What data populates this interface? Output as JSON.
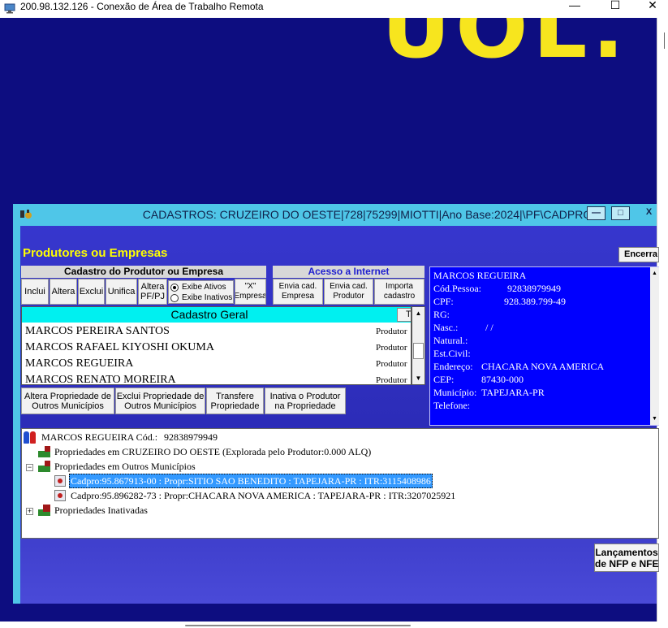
{
  "rdp_window": {
    "title": "200.98.132.126 - Conexão de Área de Trabalho Remota",
    "minimize_glyph": "—",
    "maximize_glyph": "☐",
    "close_glyph": "✕"
  },
  "desktop": {
    "wallpaper_text": "UOL."
  },
  "app_window": {
    "title": "CADASTROS: CRUZEIRO DO OESTE|728|75299|MIOTTI|Ano Base:2024|\\PF\\CADPRO",
    "minimize_glyph": "—",
    "maximize_glyph": "□",
    "close_glyph": "X"
  },
  "section_title": "Produtores ou Empresas",
  "encerra_label": "Encerra",
  "cadastro_panel": {
    "header": "Cadastro do Produtor ou Empresa",
    "buttons": [
      "Inclui",
      "Altera",
      "Exclui",
      "Unifica",
      "Altera PF/PJ",
      "\"X\" Empresa"
    ],
    "radio_options": [
      "Exibe Ativos",
      "Exibe Inativos"
    ],
    "radio_selected": "Exibe Ativos"
  },
  "internet_panel": {
    "header": "Acesso a Internet",
    "buttons": [
      "Envia cad. Empresa",
      "Envia cad. Produtor",
      "Importa cadastro"
    ]
  },
  "cadastro_geral": {
    "title": "Cadastro Geral",
    "tipo_header": "Tipo",
    "rows": [
      {
        "name": "MARCOS PEREIRA SANTOS",
        "tipo": "Produtor"
      },
      {
        "name": "MARCOS RAFAEL KIYOSHI OKUMA",
        "tipo": "Produtor"
      },
      {
        "name": "MARCOS REGUEIRA",
        "tipo": "Produtor"
      },
      {
        "name": "MARCOS RENATO MOREIRA",
        "tipo": "Produtor"
      }
    ]
  },
  "action_buttons": [
    "Altera Propriedade de Outros Municípios",
    "Exclui Propriedade de Outros Municípios",
    "Transfere Propriedade",
    "Inativa o Produtor na Propriedade"
  ],
  "details": {
    "name": "MARCOS REGUEIRA",
    "cod_pessoa_label": "Cód.Pessoa:",
    "cod_pessoa": "92838979949",
    "cpf_label": "CPF:",
    "cpf": "928.389.799-49",
    "rg_label": "RG:",
    "nasc_label": "Nasc.:",
    "nasc": "/ /",
    "natural_label": "Natural.:",
    "est_civil_label": "Est.Civil:",
    "endereco_label": "Endereço:",
    "endereco": "CHACARA NOVA AMERICA",
    "cep_label": "CEP:",
    "cep": "87430-000",
    "municipio_label": "Município:",
    "municipio": "TAPEJARA-PR",
    "telefone_label": "Telefone:"
  },
  "tree": {
    "root": "MARCOS REGUEIRA Cód.:",
    "root_code": "92838979949",
    "node_cruzeiro": "Propriedades em CRUZEIRO DO OESTE (Explorada pelo Produtor:0.000 ALQ)",
    "node_outros": "Propriedades em Outros Municípios",
    "children": [
      "Cadpro:95.867913-00  :  Propr:SITIO SAO BENEDITO  :  TAPEJARA-PR  :  ITR:3115408986",
      "Cadpro:95.896282-73  :  Propr:CHACARA NOVA AMERICA  :  TAPEJARA-PR  :  ITR:3207025921"
    ],
    "node_inativadas": "Propriedades Inativadas",
    "expander_minus": "−",
    "expander_plus": "+"
  },
  "lancamentos_label_1": "Lançamentos",
  "lancamentos_label_2": "de NFP e NFE",
  "colors": {
    "desktop_bg": "#0d0d80",
    "titlebar": "#4fc6e8",
    "yellow_title": "#ffff00",
    "list_header": "#00f0f0",
    "details_bg": "#0000ff",
    "selected": "#3399ff"
  }
}
